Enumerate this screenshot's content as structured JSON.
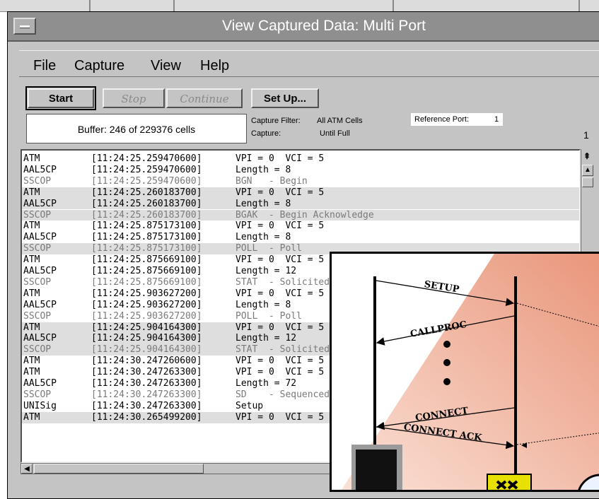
{
  "window": {
    "title": "View Captured Data: Multi Port"
  },
  "menu": {
    "items": [
      "File",
      "Capture",
      "View",
      "Help"
    ]
  },
  "toolbar": {
    "start_label": "Start",
    "stop_label": "Stop",
    "continue_label": "Continue",
    "setup_label": "Set Up..."
  },
  "status": {
    "buffer": "Buffer: 246 of 229376 cells",
    "capture_filter_label": "Capture Filter:",
    "capture_filter_value": "All ATM Cells",
    "capture_label": "Capture:",
    "capture_value": "Until Full",
    "reference_port_label": "Reference Port:",
    "reference_port_value": "1",
    "page_number": "1"
  },
  "rows": [
    {
      "proto": "ATM",
      "time": "[11:24:25.259470600]",
      "info": "VPI = 0  VCI = 5",
      "hl": false,
      "dim": false
    },
    {
      "proto": "AAL5CP",
      "time": "[11:24:25.259470600]",
      "info": "Length = 8",
      "hl": false,
      "dim": false
    },
    {
      "proto": "SSCOP",
      "time": "[11:24:25.259470600]",
      "info": "BGN   - Begin",
      "hl": false,
      "dim": true
    },
    {
      "proto": "ATM",
      "time": "[11:24:25.260183700]",
      "info": "VPI = 0  VCI = 5",
      "hl": true,
      "dim": false
    },
    {
      "proto": "AAL5CP",
      "time": "[11:24:25.260183700]",
      "info": "Length = 8",
      "hl": true,
      "dim": false
    },
    {
      "proto": "SSCOP",
      "time": "[11:24:25.260183700]",
      "info": "BGAK  - Begin Acknowledge",
      "hl": true,
      "dim": true
    },
    {
      "proto": "ATM",
      "time": "[11:24:25.875173100]",
      "info": "VPI = 0  VCI = 5",
      "hl": false,
      "dim": false
    },
    {
      "proto": "AAL5CP",
      "time": "[11:24:25.875173100]",
      "info": "Length = 8",
      "hl": false,
      "dim": false
    },
    {
      "proto": "SSCOP",
      "time": "[11:24:25.875173100]",
      "info": "POLL  - Poll",
      "hl": true,
      "dim": true
    },
    {
      "proto": "ATM",
      "time": "[11:24:25.875669100]",
      "info": "VPI = 0  VCI = 5",
      "hl": false,
      "dim": false
    },
    {
      "proto": "AAL5CP",
      "time": "[11:24:25.875669100]",
      "info": "Length = 12",
      "hl": false,
      "dim": false
    },
    {
      "proto": "SSCOP",
      "time": "[11:24:25.875669100]",
      "info": "STAT  - Solicited Status",
      "hl": false,
      "dim": true
    },
    {
      "proto": "ATM",
      "time": "[11:24:25.903627200]",
      "info": "VPI = 0  VCI = 5",
      "hl": false,
      "dim": false
    },
    {
      "proto": "AAL5CP",
      "time": "[11:24:25.903627200]",
      "info": "Length = 8",
      "hl": false,
      "dim": false
    },
    {
      "proto": "SSCOP",
      "time": "[11:24:25.903627200]",
      "info": "POLL  - Poll",
      "hl": false,
      "dim": true
    },
    {
      "proto": "ATM",
      "time": "[11:24:25.904164300]",
      "info": "VPI = 0  VCI = 5",
      "hl": true,
      "dim": false
    },
    {
      "proto": "AAL5CP",
      "time": "[11:24:25.904164300]",
      "info": "Length = 12",
      "hl": true,
      "dim": false
    },
    {
      "proto": "SSCOP",
      "time": "[11:24:25.904164300]",
      "info": "STAT  - Solicited Status",
      "hl": true,
      "dim": true
    },
    {
      "proto": "ATM",
      "time": "[11:24:30.247260600]",
      "info": "VPI = 0  VCI = 5",
      "hl": false,
      "dim": false
    },
    {
      "proto": "ATM",
      "time": "[11:24:30.247263300]",
      "info": "VPI = 0  VCI = 5",
      "hl": false,
      "dim": false
    },
    {
      "proto": "AAL5CP",
      "time": "[11:24:30.247263300]",
      "info": "Length = 72",
      "hl": false,
      "dim": false
    },
    {
      "proto": "SSCOP",
      "time": "[11:24:30.247263300]",
      "info": "SD    - Sequenced Data",
      "hl": false,
      "dim": true
    },
    {
      "proto": "UNISig",
      "time": "[11:24:30.247263300]",
      "info": "Setup",
      "hl": false,
      "dim": false
    },
    {
      "proto": "ATM",
      "time": "[11:24:30.265499200]",
      "info": "VPI = 0  VCI = 5",
      "hl": true,
      "dim": false
    }
  ],
  "diagram": {
    "messages": [
      "SETUP",
      "CALLPROC",
      "CONNECT",
      "CONNECT ACK"
    ],
    "colors": {
      "gradient_start": "#e9957a",
      "gradient_end": "#fbe3d8",
      "terminal": "#111111",
      "switch": "#e8e000"
    }
  }
}
